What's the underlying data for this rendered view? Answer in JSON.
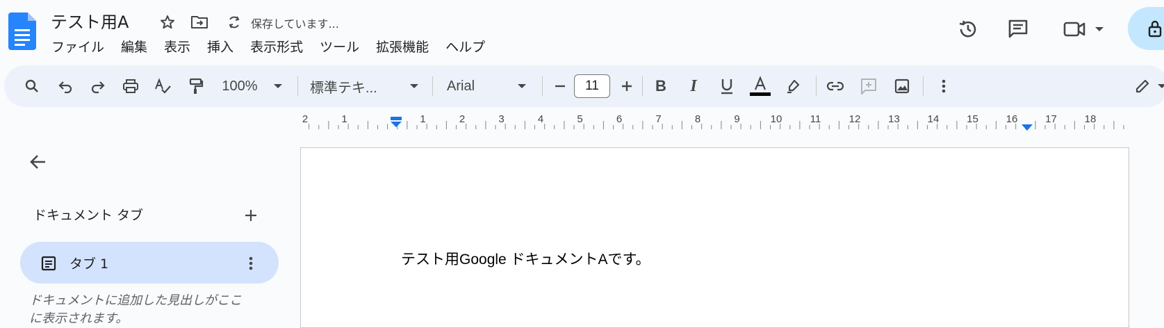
{
  "header": {
    "doc_title": "テスト用A",
    "save_status": "保存しています..."
  },
  "menu": [
    "ファイル",
    "編集",
    "表示",
    "挿入",
    "表示形式",
    "ツール",
    "拡張機能",
    "ヘルプ"
  ],
  "toolbar": {
    "zoom": "100%",
    "style": "標準テキ...",
    "font": "Arial",
    "font_size": "11",
    "text_color": "#000000"
  },
  "ruler": {
    "labels": [
      "2",
      "1",
      "1",
      "2",
      "3",
      "4",
      "5",
      "6",
      "7",
      "8",
      "9",
      "10",
      "11",
      "12",
      "13",
      "14",
      "15",
      "16",
      "17",
      "18"
    ]
  },
  "sidebar": {
    "heading": "ドキュメント タブ",
    "tab_label": "タブ 1",
    "hint": "ドキュメントに追加した見出しがここに表示されます。"
  },
  "document": {
    "body_text": "テスト用Google ドキュメントAです。"
  },
  "colors": {
    "accent": "#1a73e8",
    "toolbar_bg": "#edf2fa",
    "tab_active_bg": "#d3e3fd",
    "share_bg": "#c2e7ff"
  }
}
